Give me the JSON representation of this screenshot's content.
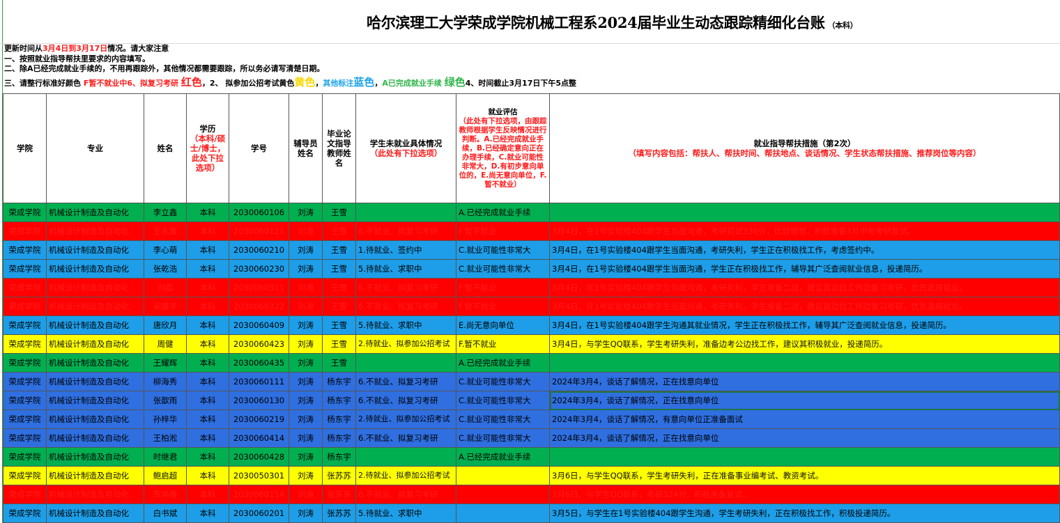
{
  "title": "哈尔滨理工大学荣成学院机械工程系2024届毕业生动态跟踪精细化台账",
  "title_suffix": "（本科）",
  "notes": {
    "line1_a": "更新时间从",
    "line1_b": "3月4日到3月17日",
    "line1_c": "情况。请大家注意",
    "line2": "一、按照就业指导帮扶里要求的内容填写。",
    "line3": "二、除A已经完成就业手续的，不用再跟踪外，其他情况都需要跟踪，所以务必请写清楚日期。",
    "line4_a": "三、请整行标准好颜色 ",
    "line4_b": "F暂不就业中6、拟复习考研 ",
    "line4_c": "红色",
    "line4_d": "，2、 拟参加公招考试黄色",
    "line4_e": "黄色",
    "line4_f": "，",
    "line4_g": "其他标注",
    "line4_h": "蓝色",
    "line4_i": "，",
    "line4_j": "A已完成就业手续 ",
    "line4_k": "绿色",
    "line4_l": "4、时间截止3月17日下午5点整"
  },
  "headers": {
    "college": "学院",
    "major": "专业",
    "name": "姓名",
    "degree": "学历",
    "degree_sub": "（本科/硕士/博士，此处下拉选项）",
    "student_id": "学号",
    "counselor": "辅导员姓名",
    "advisor": "毕业论文指导教师姓名",
    "situation": "学生未就业具体情况",
    "situation_sub": "（此处有下拉选项）",
    "eval": "就业评估",
    "eval_sub": "（此处有下拉选项，由跟踪教师根据学生反映情况进行判断。A.已经完成就业手续，B.已经确定意向正在办理手续，C.就业可能性非常大，D.有初步意向单位的，E.尚无意向单位，F.暂不就业）",
    "measures": "就业指导帮扶措施（第2次）",
    "measures_sub": "（填写内容包括：帮扶人、帮扶时间、帮扶地点、谈话情况、学生状态帮扶措施、推荐岗位等内容）"
  },
  "rows": [
    {
      "color": "green",
      "college": "荣成学院",
      "major": "机械设计制造及自动化",
      "name": "李立鑫",
      "degree": "本科",
      "id": "2030060106",
      "counselor": "刘涛",
      "advisor": "王雪",
      "situation": "",
      "eval": "A.已经完成就业手续",
      "measure": ""
    },
    {
      "color": "red",
      "college": "荣成学院",
      "major": "机械设计制造及自动化",
      "name": "王永鑫",
      "degree": "本科",
      "id": "2030060121",
      "counselor": "刘涛",
      "advisor": "王雪",
      "situation": "6.不就业、拟复习考研",
      "eval": "F.暂不就业",
      "measure": "3月4日，在1号实验楼404跟学生当面沟通，考研初试336分，比较理想，积极准备3月中旬考研复试。"
    },
    {
      "color": "blue",
      "college": "荣成学院",
      "major": "机械设计制造及自动化",
      "name": "李心萌",
      "degree": "本科",
      "id": "2030060210",
      "counselor": "刘涛",
      "advisor": "王雪",
      "situation": "1.待就业、签约中",
      "eval": "C.就业可能性非常大",
      "measure": "3月4日，在1号实验楼404跟学生当面沟通，考研失利，学生正在积极找工作，考虑签约中。"
    },
    {
      "color": "blue",
      "college": "荣成学院",
      "major": "机械设计制造及自动化",
      "name": "张乾浩",
      "degree": "本科",
      "id": "2030060230",
      "counselor": "刘涛",
      "advisor": "王雪",
      "situation": "5.待就业、求职中",
      "eval": "C.就业可能性非常大",
      "measure": "3月4日，在1号实验楼404跟学生当面沟通，学生正在积极找工作，辅导其广泛查阅就业信息，投递简历。"
    },
    {
      "color": "red",
      "college": "荣成学院",
      "major": "机械设计制造及自动化",
      "name": "刘磊",
      "degree": "本科",
      "id": "2030060311",
      "counselor": "刘涛",
      "advisor": "王雪",
      "situation": "6.不就业、拟复习考研",
      "eval": "F.暂不就业",
      "measure": "3月4日，在1号实验楼404跟学生当面沟通，考研失利，学生准备二战，建议其边找工作边复习考研，优先选择就业。"
    },
    {
      "color": "red",
      "college": "荣成学院",
      "major": "机械设计制造及自动化",
      "name": "宋震宇",
      "degree": "本科",
      "id": "2030060322",
      "counselor": "刘涛",
      "advisor": "王雪",
      "situation": "6.不就业、拟复习考研",
      "eval": "F.暂不就业",
      "measure": "3月4日，在1号实验楼404跟学生当面沟通，考研失利，学生准备二战，建议其边找工作边复习考研，优先选择就业。"
    },
    {
      "color": "blue",
      "college": "荣成学院",
      "major": "机械设计制造及自动化",
      "name": "唐欣月",
      "degree": "本科",
      "id": "2030060409",
      "counselor": "刘涛",
      "advisor": "王雪",
      "situation": "5.待就业、求职中",
      "eval": "E.尚无意向单位",
      "measure": "3月4日，在1号实验楼404跟学生沟通其就业情况，学生正在积极找工作，辅导其广泛查阅就业信息，投递简历。"
    },
    {
      "color": "yellow",
      "college": "荣成学院",
      "major": "机械设计制造及自动化",
      "name": "周健",
      "degree": "本科",
      "id": "2030060423",
      "counselor": "刘涛",
      "advisor": "王雪",
      "situation": "2.待就业、拟参加公招考试",
      "eval": "F.暂不就业",
      "measure": "3月4日，与学生QQ联系，学生考研失利，准备边考公边找工作，建议其积极就业，投递简历。"
    },
    {
      "color": "green",
      "college": "荣成学院",
      "major": "机械设计制造及自动化",
      "name": "王耀辉",
      "degree": "本科",
      "id": "2030060435",
      "counselor": "刘涛",
      "advisor": "王雪",
      "situation": "",
      "eval": "A.已经完成就业手续",
      "measure": ""
    },
    {
      "color": "darkblue",
      "college": "荣成学院",
      "major": "机械设计制造及自动化",
      "name": "柳海秀",
      "degree": "本科",
      "id": "2030060111",
      "counselor": "刘涛",
      "advisor": "杨东宇",
      "situation": "6.不就业、拟复习考研",
      "eval": "C.就业可能性非常大",
      "measure": "2024年3月4，谈话了解情况，正在找意向单位"
    },
    {
      "color": "darkblue",
      "college": "荣成学院",
      "major": "机械设计制造及自动化",
      "name": "张歆雨",
      "degree": "本科",
      "id": "2030060130",
      "counselor": "刘涛",
      "advisor": "杨东宇",
      "situation": "6.不就业、拟复习考研",
      "eval": "C.就业可能性非常大",
      "measure": "2024年3月4，谈话了解情况，正在找意向单位",
      "selected": true
    },
    {
      "color": "darkblue",
      "college": "荣成学院",
      "major": "机械设计制造及自动化",
      "name": "孙梓华",
      "degree": "本科",
      "id": "2030060219",
      "counselor": "刘涛",
      "advisor": "杨东宇",
      "situation": "2.待就业、拟参加公招考试",
      "eval": "C.就业可能性非常大",
      "measure": "2024年3月4，谈话了解情况，有意向单位正准备面试"
    },
    {
      "color": "darkblue",
      "college": "荣成学院",
      "major": "机械设计制造及自动化",
      "name": "王柏淞",
      "degree": "本科",
      "id": "2030060414",
      "counselor": "刘涛",
      "advisor": "杨东宇",
      "situation": "6.不就业、拟复习考研",
      "eval": "C.就业可能性非常大",
      "measure": "2024年3月4，谈话了解情况，正在找意向单位"
    },
    {
      "color": "green",
      "college": "荣成学院",
      "major": "机械设计制造及自动化",
      "name": "时继君",
      "degree": "本科",
      "id": "2030060428",
      "counselor": "刘涛",
      "advisor": "杨东宇",
      "situation": "",
      "eval": "A.已经完成就业手续",
      "measure": ""
    },
    {
      "color": "yellow",
      "college": "荣成学院",
      "major": "机械设计制造及自动化",
      "name": "鲍启超",
      "degree": "本科",
      "id": "2030050301",
      "counselor": "刘涛",
      "advisor": "张苏苏",
      "situation": "2.待就业、拟参加公招考试",
      "eval": "",
      "measure": "3月6日，与学生QQ联系，学生考研失利，正在准备事业编考试、教资考试。"
    },
    {
      "color": "red",
      "college": "荣成学院",
      "major": "机械设计制造及自动化",
      "name": "苏鸿春",
      "degree": "本科",
      "id": "2030060114",
      "counselor": "刘涛",
      "advisor": "张苏苏",
      "situation": "6.不就业、拟复习考研",
      "eval": "",
      "measure": "3月6日，与学生QQ联系，考研324分，积极准备复试。"
    },
    {
      "color": "blue",
      "college": "荣成学院",
      "major": "机械设计制造及自动化",
      "name": "白书斌",
      "degree": "本科",
      "id": "2030060201",
      "counselor": "刘涛",
      "advisor": "张苏苏",
      "situation": "5.待就业、求职中",
      "eval": "",
      "measure": "3月5日，与学生在1号实验楼404跟学生沟通，学生考研失利，正在积极找工作，积极投递简历。"
    }
  ]
}
